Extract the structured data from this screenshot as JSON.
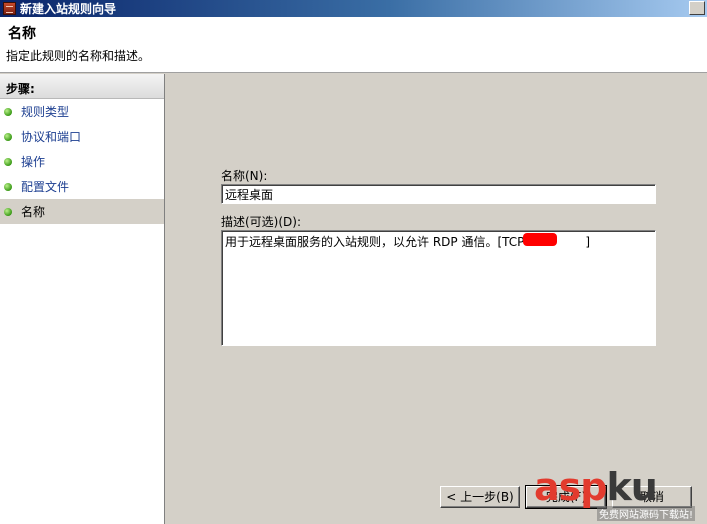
{
  "window": {
    "title": "新建入站规则向导"
  },
  "header": {
    "title": "名称",
    "subtitle": "指定此规则的名称和描述。"
  },
  "steps": {
    "header": "步骤:",
    "items": [
      {
        "label": "规则类型"
      },
      {
        "label": "协议和端口"
      },
      {
        "label": "操作"
      },
      {
        "label": "配置文件"
      },
      {
        "label": "名称",
        "active": true
      }
    ]
  },
  "form": {
    "name_label": "名称(N):",
    "name_value": "远程桌面",
    "desc_label": "描述(可选)(D):",
    "desc_value": "用于远程桌面服务的入站规则，以允许 RDP 通信。[TCP                ]"
  },
  "buttons": {
    "back": "< 上一步(B)",
    "finish": "完成(F)",
    "cancel": "取消"
  },
  "watermark": {
    "brand_red": "asp",
    "brand_dark": "ku",
    "sub": "免费网站源码下载站!"
  },
  "colors": {
    "title_bar": "#0a246a",
    "dialog_bg": "#d4d0c8",
    "step_link": "#1d3f91",
    "redaction": "#ff0000"
  }
}
